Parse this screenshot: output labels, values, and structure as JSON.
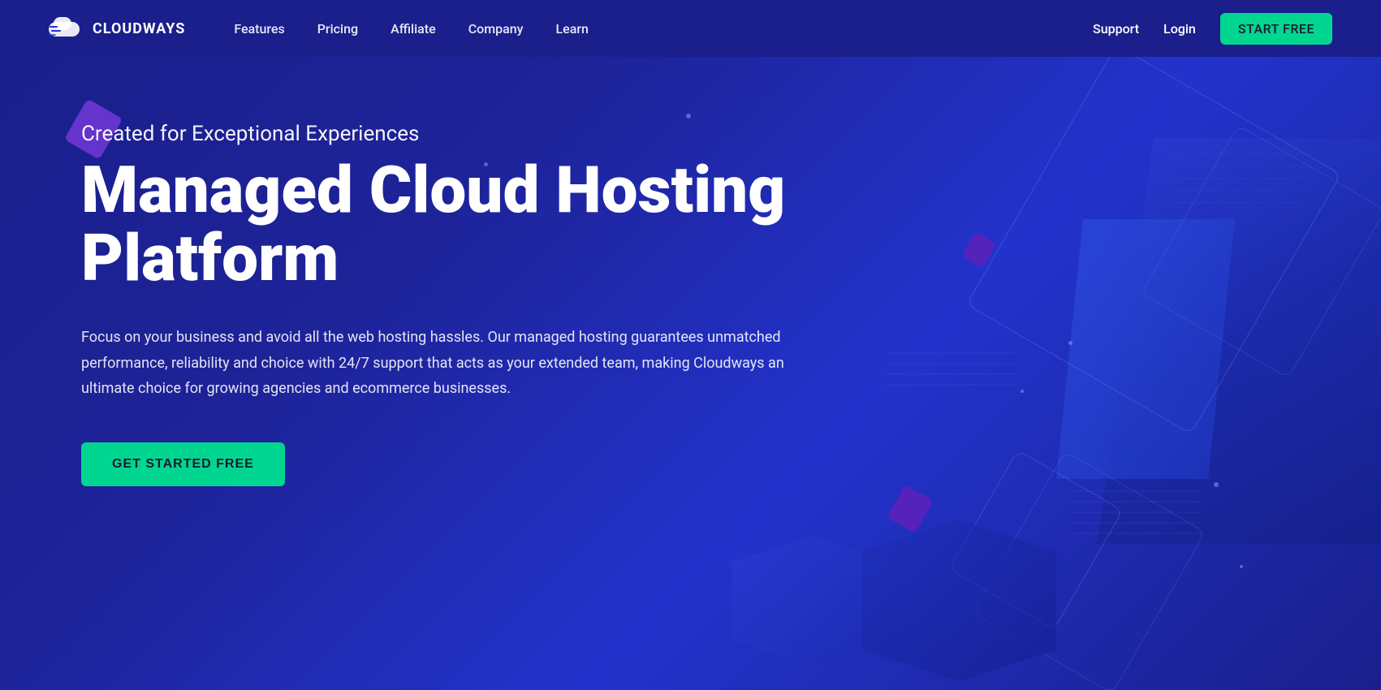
{
  "nav": {
    "logo_text": "CLOUDWAYS",
    "links": [
      {
        "label": "Features",
        "id": "features"
      },
      {
        "label": "Pricing",
        "id": "pricing"
      },
      {
        "label": "Affiliate",
        "id": "affiliate"
      },
      {
        "label": "Company",
        "id": "company"
      },
      {
        "label": "Learn",
        "id": "learn"
      }
    ],
    "right_links": [
      {
        "label": "Support",
        "id": "support"
      },
      {
        "label": "Login",
        "id": "login"
      }
    ],
    "cta_label": "START FREE"
  },
  "hero": {
    "subtitle": "Created for Exceptional Experiences",
    "title": "Managed Cloud Hosting\nPlatform",
    "description": "Focus on your business and avoid all the web hosting hassles. Our managed hosting guarantees unmatched performance, reliability and choice with 24/7 support that acts as your extended team, making Cloudways an ultimate choice for growing agencies and ecommerce businesses.",
    "cta_label": "GET STARTED FREE"
  }
}
